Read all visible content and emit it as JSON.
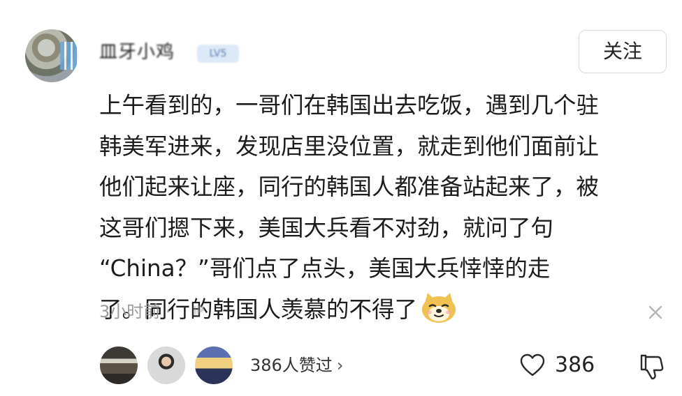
{
  "author": {
    "name": "皿牙小鸡",
    "badge": "LV5"
  },
  "follow_label": "关注",
  "post": {
    "lines": [
      "上午看到的，一哥们在韩国出去吃饭，遇到几个驻",
      "韩美军进来，发现店里没位置，就走到他们面前让",
      "他们起来让座，同行的韩国人都准备站起来了，被",
      "这哥们摁下来，美国大兵看不对劲，就问了句",
      "“China？”哥们点了点头，美国大兵悻悻的走",
      "了。同行的韩国人羡慕的不得了"
    ],
    "trailing_emoji": "doge-emoji"
  },
  "meta": {
    "time": "3小时前 ·",
    "location": "IP"
  },
  "engagement": {
    "likers_summary": "386人赞过",
    "chevron": "›",
    "like_count": "386"
  },
  "colors": {
    "muted_text": "#9a9a9a",
    "follow_border": "#d9d9d9",
    "badge_bg": "#dce9f7"
  },
  "icons": [
    "doge-emoji",
    "close-icon",
    "chevron-right-icon",
    "heart-icon",
    "thumbs-down-icon"
  ]
}
